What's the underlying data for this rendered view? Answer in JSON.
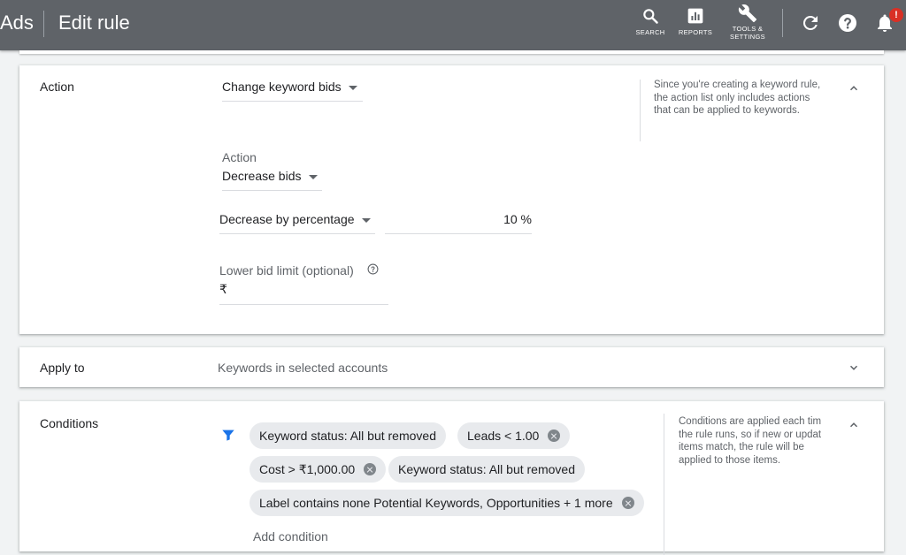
{
  "header": {
    "brand": "Ads",
    "title": "Edit rule",
    "tools": [
      {
        "label": "SEARCH",
        "icon": "search-icon"
      },
      {
        "label": "REPORTS",
        "icon": "reports-icon"
      },
      {
        "label_line1": "TOOLS &",
        "label_line2": "SETTINGS",
        "icon": "wrench-icon"
      }
    ],
    "notification_count": "!"
  },
  "action_card": {
    "label": "Action",
    "rule_action": "Change keyword bids",
    "action_sublabel": "Action",
    "action_value": "Decrease bids",
    "method": "Decrease by percentage",
    "amount": "10",
    "amount_unit": "%",
    "lower_limit_label": "Lower bid limit (optional)",
    "lower_limit_currency": "₹",
    "help_text": "Since you're creating a keyword rule, the action list only includes actions that can be applied to keywords."
  },
  "apply_card": {
    "label": "Apply to",
    "value": "Keywords in selected accounts"
  },
  "conditions_card": {
    "label": "Conditions",
    "chips": [
      {
        "text": "Keyword status: All but removed",
        "removable": false
      },
      {
        "text": "Leads < 1.00",
        "removable": true
      },
      {
        "text": "Cost > ₹1,000.00",
        "removable": true
      },
      {
        "text": "Keyword status: All but removed",
        "removable": false
      },
      {
        "text": "Label contains none Potential Keywords, Opportunities + 1 more",
        "removable": true
      }
    ],
    "add_condition": "Add condition",
    "help_text": "Conditions are applied each tim the rule runs, so if new or updat items match, the rule will be applied to those items."
  },
  "colors": {
    "topbar": "#5f6368",
    "accent_blue": "#1a73e8",
    "chip_bg": "#e8eaed",
    "alert_red": "#d93025"
  }
}
